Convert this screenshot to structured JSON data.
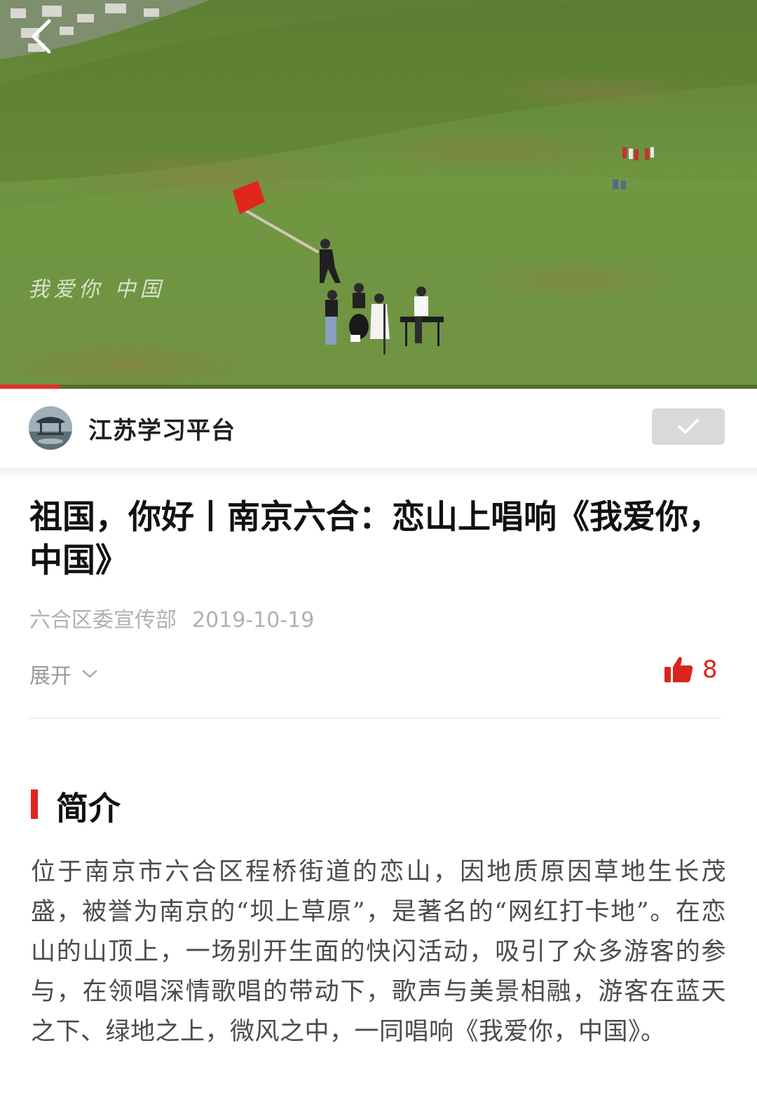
{
  "video": {
    "caption": "我爱你 中国",
    "progress_percent": 8,
    "back_icon": "chevron-left-icon"
  },
  "publisher": {
    "name": "江苏学习平台",
    "follow_icon": "check-icon"
  },
  "article": {
    "title": "祖国，你好丨南京六合：恋山上唱响《我爱你，中国》",
    "source": "六合区委宣传部",
    "date": "2019-10-19",
    "expand_label": "展开",
    "like_count": "8",
    "like_color": "#d9241c"
  },
  "intro": {
    "heading": "简介",
    "accent_color": "#e0241f",
    "body": "位于南京市六合区程桥街道的恋山，因地质原因草地生长茂盛，被誉为南京的“坝上草原”，是著名的“网红打卡地”。在恋山的山顶上，一场别开生面的快闪活动，吸引了众多游客的参与，在领唱深情歌唱的带动下，歌声与美景相融，游客在蓝天之下、绿地之上，微风之中，一同唱响《我爱你，中国》。"
  }
}
